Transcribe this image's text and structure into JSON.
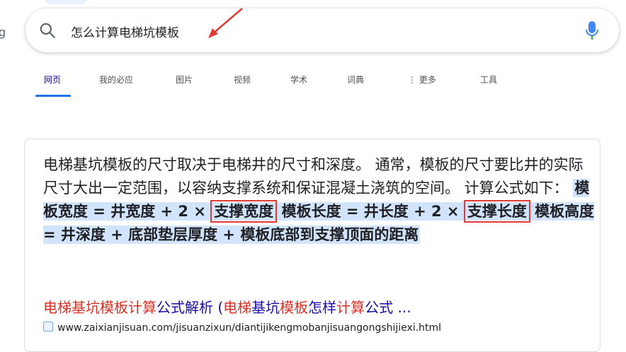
{
  "logo_fragment": "g",
  "search": {
    "query": "怎么计算电梯坑模板"
  },
  "nav": {
    "tabs": [
      {
        "label": "网页",
        "active": true
      },
      {
        "label": "我的必应",
        "active": false
      },
      {
        "label": "图片",
        "active": false
      },
      {
        "label": "视频",
        "active": false
      },
      {
        "label": "学术",
        "active": false
      },
      {
        "label": "词典",
        "active": false
      },
      {
        "label": "⋮ 更多",
        "active": false
      },
      {
        "label": "工具",
        "active": false
      }
    ]
  },
  "result": {
    "snippet_intro": "电梯基坑模板的尺寸取决于电梯井的尺寸和深度。 通常，模板的尺寸要比井的实际尺寸大出一定范围，以容纳支撑系统和保证混凝土浇筑的空间。 计算公式如下：",
    "formula_a": "模板宽度 = 井宽度 + 2 × ",
    "formula_b_boxed": "支撑宽度",
    "formula_c": " 模板长度 = 井长度 + 2 × ",
    "formula_d_boxed": "支撑长度",
    "formula_e": " 模板高度 = 井深度 + 底部垫层厚度 + 模板底部到支撑顶面的距离",
    "title_parts": [
      "电梯基坑",
      "模板",
      "计算",
      "公式解析 (",
      "电梯",
      "基坑",
      "模板",
      "怎样",
      "计算",
      "公式 ..."
    ],
    "url": "www.zaixianjisuan.com/jisuanzixun/diantijikengmobanjisuangongshijiexi.html"
  },
  "colors": {
    "link": "#1a0dab",
    "keyword": "#d93025",
    "highlight": "#d2e3fc",
    "annotation": "#e53935",
    "accent": "#1a73e8"
  },
  "icons": [
    "search-icon",
    "microphone-icon",
    "annotation-arrow",
    "site-favicon"
  ]
}
